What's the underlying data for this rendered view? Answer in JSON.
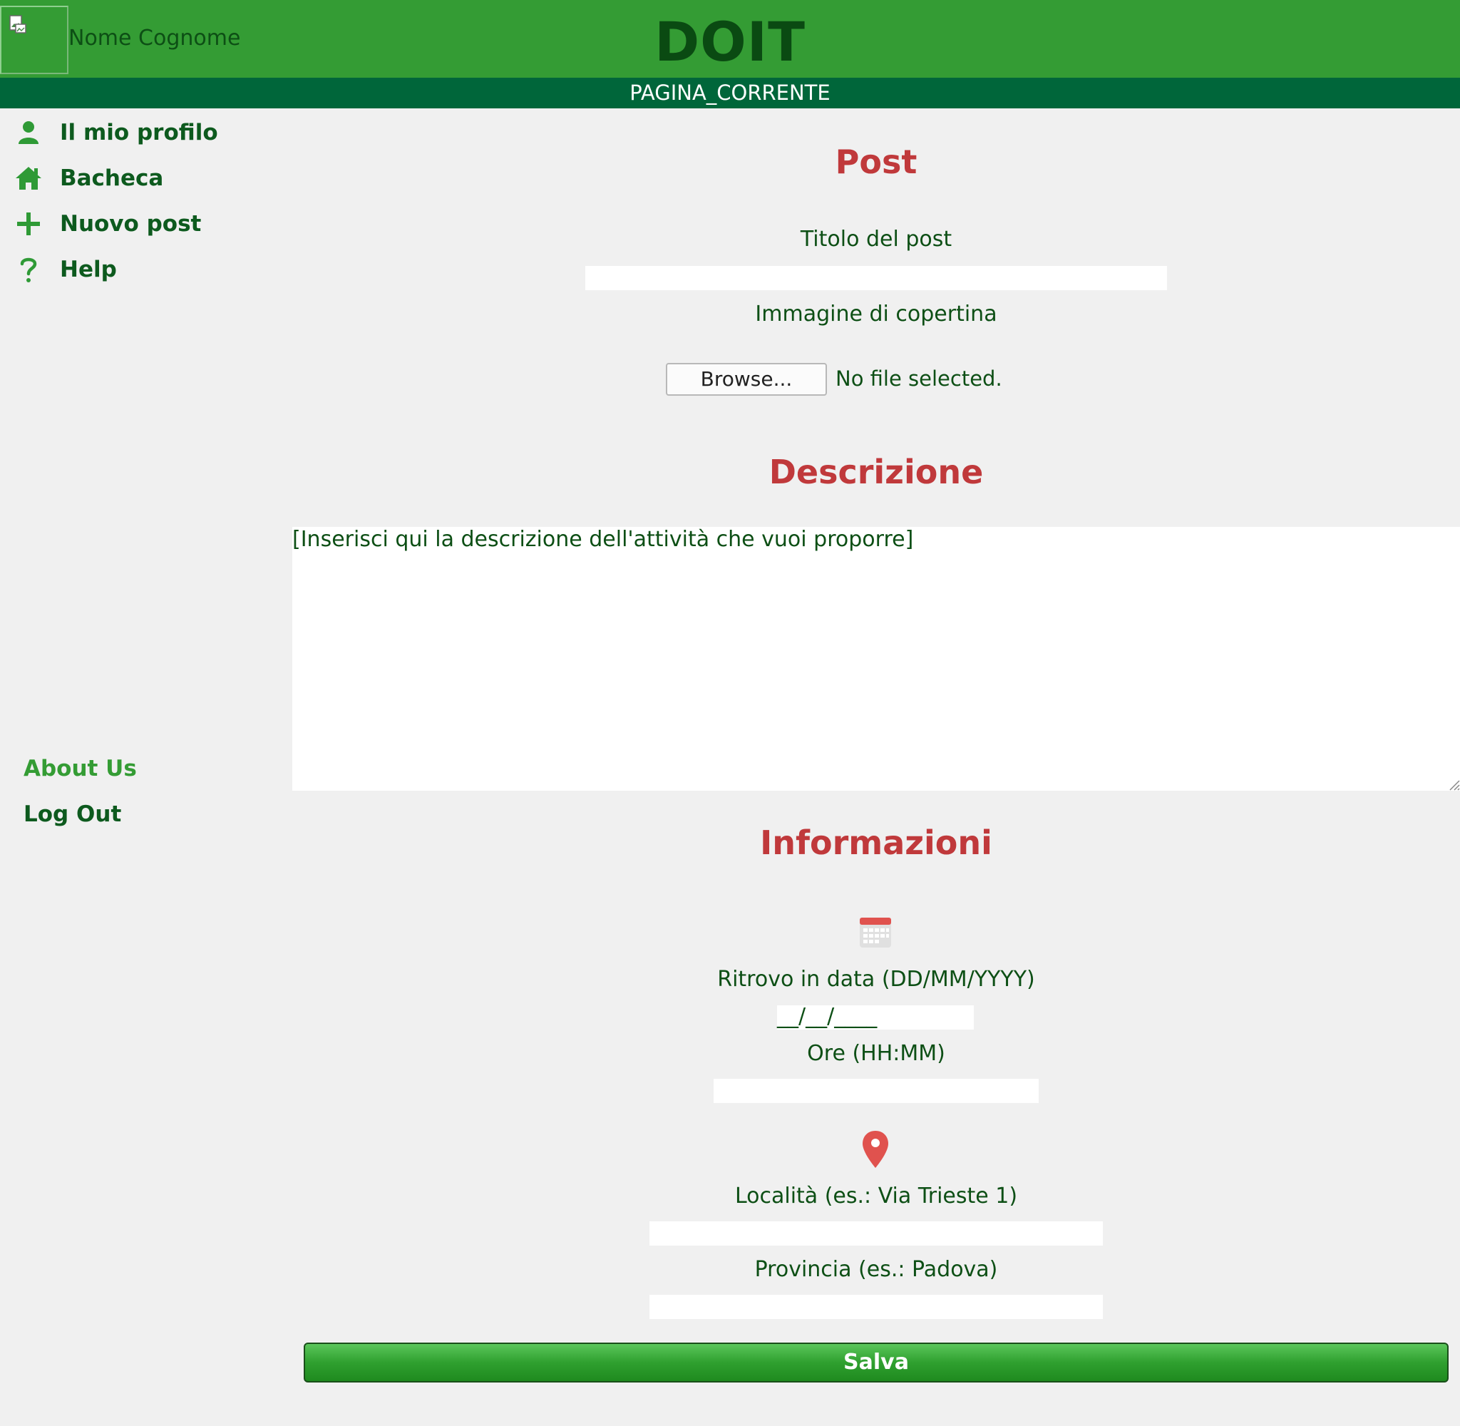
{
  "header": {
    "user_name": "Nome Cognome",
    "brand": "DOIT",
    "current_page": "PAGINA_CORRENTE"
  },
  "sidebar": {
    "items": [
      {
        "label": "Il mio profilo",
        "icon": "user-icon"
      },
      {
        "label": "Bacheca",
        "icon": "home-icon"
      },
      {
        "label": "Nuovo post",
        "icon": "plus-icon"
      },
      {
        "label": "Help",
        "icon": "question-icon"
      }
    ],
    "footer": {
      "about": "About Us",
      "logout": "Log Out"
    }
  },
  "post": {
    "title": "Post",
    "title_label": "Titolo del post",
    "cover_label": "Immagine di copertina",
    "browse_label": "Browse...",
    "no_file": "No file selected."
  },
  "description": {
    "title": "Descrizione",
    "placeholder": "[Inserisci qui la descrizione dell'attività che vuoi proporre]"
  },
  "info": {
    "title": "Informazioni",
    "date_label": "Ritrovo in data (DD/MM/YYYY)",
    "date_value": "__/__/____",
    "time_label": "Ore (HH:MM)",
    "location_label": "Località (es.: Via Trieste 1)",
    "province_label": "Provincia (es.: Padova)"
  },
  "actions": {
    "save": "Salva"
  },
  "colors": {
    "header_bg": "#349c34",
    "subbar_bg": "#00663a",
    "section_title": "#c0393b",
    "text_green": "#0d5a1e",
    "page_bg": "#f0f0f0"
  }
}
